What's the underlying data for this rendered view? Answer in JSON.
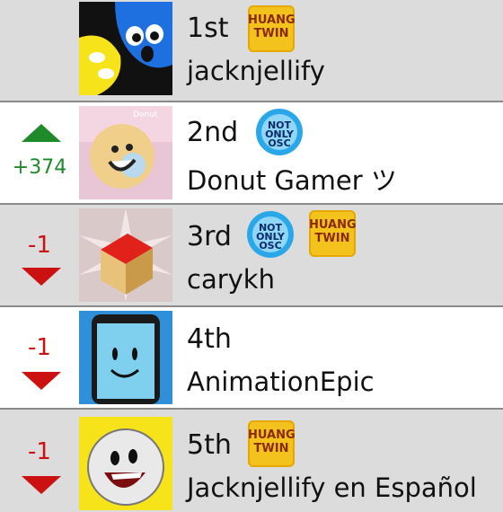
{
  "rows": [
    {
      "rank": "1st",
      "name": "jacknjellify",
      "change": "",
      "direction": "none",
      "badges": [
        "huang"
      ],
      "avatar_icon": "four-character-icon"
    },
    {
      "rank": "2nd",
      "name": "Donut Gamer ツ",
      "change": "+374",
      "direction": "up",
      "badges": [
        "not-only-osc"
      ],
      "avatar_icon": "donut-character-icon"
    },
    {
      "rank": "3rd",
      "name": "carykh",
      "change": "-1",
      "direction": "down",
      "badges": [
        "not-only-osc",
        "huang"
      ],
      "avatar_icon": "cube-icon"
    },
    {
      "rank": "4th",
      "name": "AnimationEpic",
      "change": "-1",
      "direction": "down",
      "badges": [],
      "avatar_icon": "smartphone-character-icon"
    },
    {
      "rank": "5th",
      "name": "Jacknjellify en Español",
      "change": "-1",
      "direction": "down",
      "badges": [
        "huang"
      ],
      "avatar_icon": "golfball-character-icon"
    }
  ],
  "badges": {
    "huang": {
      "line1": "HUANG",
      "line2": "TWIN"
    },
    "not_only_osc": {
      "line1": "NOT",
      "line2": "ONLY",
      "line3": "OSC"
    }
  },
  "colors": {
    "up": "#1f8a2a",
    "down": "#cc1111",
    "row_gray": "#dcdcdc",
    "badge_gold": "#f4c21d",
    "badge_blue": "#2aa7e8"
  }
}
